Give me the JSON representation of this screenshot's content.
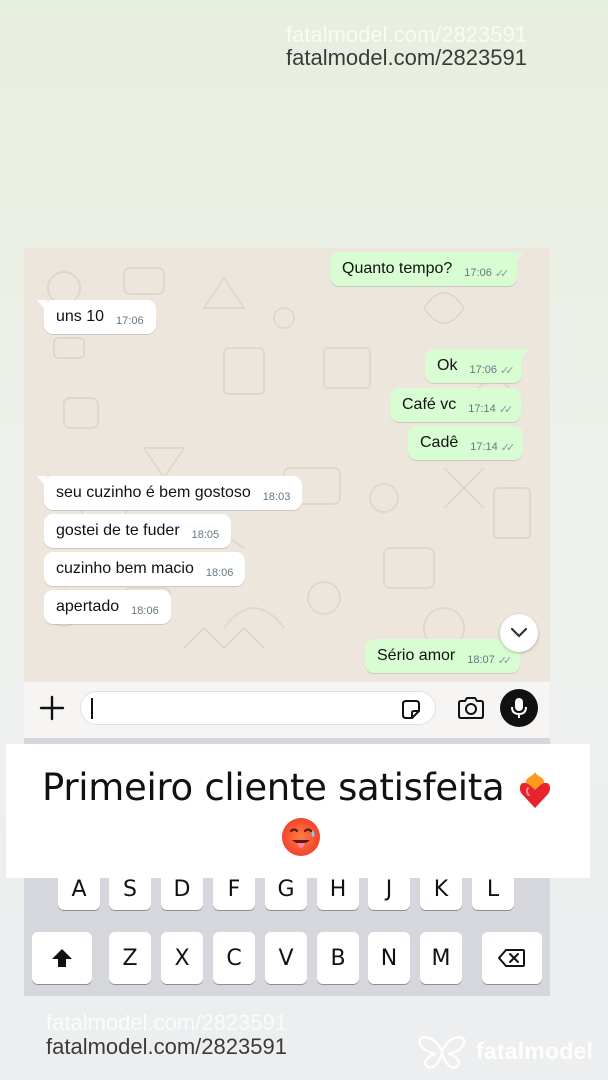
{
  "watermark": {
    "top": "fatalmodel.com/2823591",
    "bottom": "fatalmodel.com/2823591",
    "brand": "fatalmodel"
  },
  "messages": [
    {
      "dir": "out",
      "text": "Quanto tempo?",
      "time": "17:06"
    },
    {
      "dir": "in",
      "text": "uns 10",
      "time": "17:06"
    },
    {
      "dir": "out",
      "text": "Ok",
      "time": "17:06"
    },
    {
      "dir": "out",
      "text": "Café vc",
      "time": "17:14"
    },
    {
      "dir": "out",
      "text": "Cadê",
      "time": "17:14"
    },
    {
      "dir": "in",
      "text": "seu cuzinho é bem gostoso",
      "time": "18:03"
    },
    {
      "dir": "in",
      "text": "gostei de te fuder",
      "time": "18:05"
    },
    {
      "dir": "in",
      "text": "cuzinho bem macio",
      "time": "18:06"
    },
    {
      "dir": "in",
      "text": "apertado",
      "time": "18:06"
    },
    {
      "dir": "out",
      "text": "Sério amor",
      "time": "18:07"
    }
  ],
  "ticks": "✓✓",
  "keyboard": {
    "row2": [
      "A",
      "S",
      "D",
      "F",
      "G",
      "H",
      "J",
      "K",
      "L"
    ],
    "row3": [
      "Z",
      "X",
      "C",
      "V",
      "B",
      "N",
      "M"
    ]
  },
  "caption": {
    "text": "Primeiro cliente satisfeita"
  },
  "icons": [
    "plus-icon",
    "sticker-icon",
    "camera-icon",
    "mic-icon",
    "chevron-down-icon",
    "shift-icon",
    "backspace-icon",
    "heart-on-fire-emoji",
    "hot-face-emoji"
  ],
  "colors": {
    "outgoing_bubble": "#d9fdd3",
    "incoming_bubble": "#ffffff",
    "chat_background": "#ece6dc",
    "keyboard": "#d5d7dc"
  }
}
